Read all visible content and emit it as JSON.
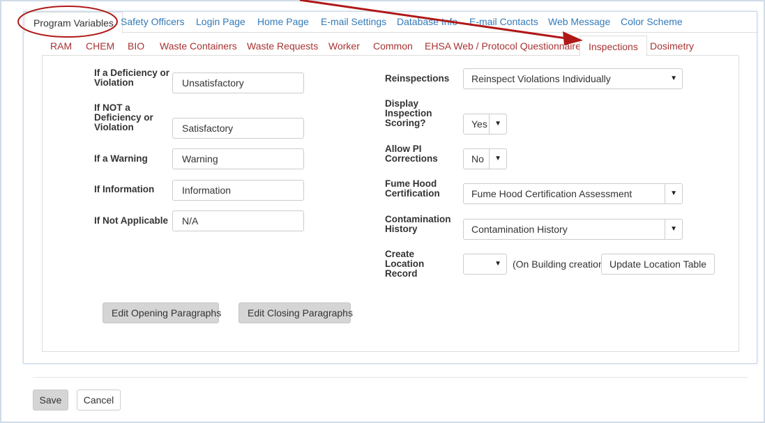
{
  "top_tabs": [
    {
      "label": "Program Variables",
      "active": true
    },
    {
      "label": "Safety Officers"
    },
    {
      "label": "Login Page"
    },
    {
      "label": "Home Page"
    },
    {
      "label": "E-mail Settings"
    },
    {
      "label": "Database Info"
    },
    {
      "label": "E-mail Contacts"
    },
    {
      "label": "Web Message"
    },
    {
      "label": "Color Scheme"
    }
  ],
  "sub_tabs": [
    {
      "label": "RAM"
    },
    {
      "label": "CHEM"
    },
    {
      "label": "BIO"
    },
    {
      "label": "Waste Containers"
    },
    {
      "label": "Waste Requests"
    },
    {
      "label": "Worker"
    },
    {
      "label": "Common"
    },
    {
      "label": "EHSA Web / Protocol Questionnaires"
    },
    {
      "label": "Inspections",
      "active": true
    },
    {
      "label": "Dosimetry"
    }
  ],
  "left_fields": [
    {
      "label": "If a Deficiency or Violation",
      "value": "Unsatisfactory"
    },
    {
      "label": "If NOT a Deficiency or Violation",
      "value": "Satisfactory"
    },
    {
      "label": "If a Warning",
      "value": "Warning"
    },
    {
      "label": "If Information",
      "value": "Information"
    },
    {
      "label": "If Not Applicable",
      "value": "N/A"
    }
  ],
  "right_fields": {
    "reinspections": {
      "label": "Reinspections",
      "value": "Reinspect Violations Individually"
    },
    "display_scoring": {
      "label": "Display Inspection Scoring?",
      "value": "Yes"
    },
    "allow_pi": {
      "label": "Allow PI Corrections",
      "value": "No"
    },
    "fume_hood": {
      "label": "Fume Hood Certification",
      "value": "Fume Hood Certification Assessment"
    },
    "contamination": {
      "label": "Contamination History",
      "value": "Contamination History"
    },
    "create_location": {
      "label": "Create Location Record",
      "value": "",
      "note": "(On Building creation)",
      "button": "Update Location Table"
    }
  },
  "paragraph_buttons": {
    "opening": "Edit Opening Paragraphs",
    "closing": "Edit Closing Paragraphs"
  },
  "footer": {
    "save": "Save",
    "cancel": "Cancel"
  },
  "colors": {
    "link_blue": "#337ab7",
    "subtab_red": "#a83232",
    "annotation_red": "#b01818"
  }
}
